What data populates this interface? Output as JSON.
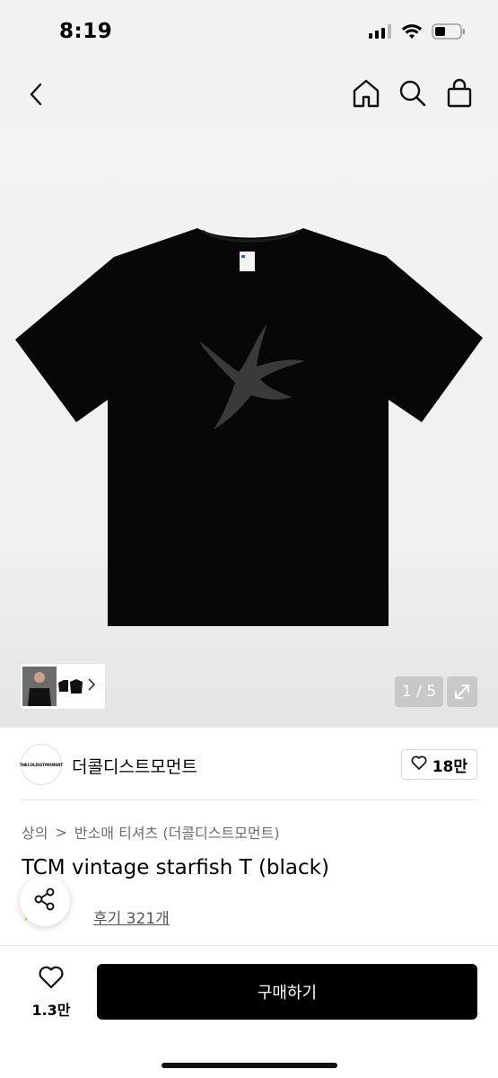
{
  "status_bar": {
    "time": "8:19"
  },
  "nav": {
    "icons": [
      "back-chevron-icon",
      "home-icon",
      "search-icon",
      "shopping-bag-icon"
    ]
  },
  "gallery": {
    "counter": "1 / 5"
  },
  "store": {
    "logo_text": "THECOLDISTMOMENT",
    "name": "더콜디스트모먼트",
    "like_count": "18만"
  },
  "breadcrumb": {
    "category": "상의",
    "separator": ">",
    "subcategory": "반소매 티셔츠 (더콜디스트모먼트)"
  },
  "product": {
    "title": "TCM vintage starfish T (black)",
    "rating_reviews": "후기 321개"
  },
  "bottom_bar": {
    "wish_count": "1.3만",
    "buy_label": "구매하기"
  },
  "colors": {
    "accent": "#000000",
    "hero_bg": "#f2f2f2",
    "counter_bg": "#c8c8c8"
  }
}
